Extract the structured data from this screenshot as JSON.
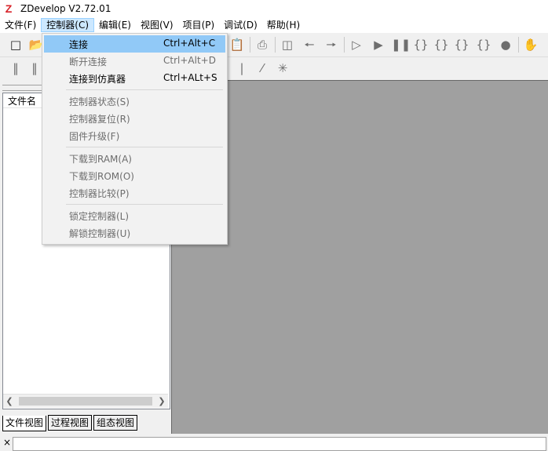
{
  "window": {
    "title": "ZDevelop V2.72.01",
    "icon": "Z"
  },
  "menubar": [
    {
      "label": "文件(F)",
      "active": false
    },
    {
      "label": "控制器(C)",
      "active": true
    },
    {
      "label": "编辑(E)",
      "active": false
    },
    {
      "label": "视图(V)",
      "active": false
    },
    {
      "label": "项目(P)",
      "active": false
    },
    {
      "label": "调试(D)",
      "active": false
    },
    {
      "label": "帮助(H)",
      "active": false
    }
  ],
  "controller_menu": {
    "items": [
      {
        "label": "连接",
        "shortcut": "Ctrl+Alt+C",
        "enabled": true,
        "highlighted": true
      },
      {
        "label": "断开连接",
        "shortcut": "Ctrl+Alt+D",
        "enabled": false
      },
      {
        "label": "连接到仿真器",
        "shortcut": "Ctrl+ALt+S",
        "enabled": true
      },
      {
        "label": "控制器状态(S)",
        "shortcut": "",
        "enabled": false
      },
      {
        "label": "控制器复位(R)",
        "shortcut": "",
        "enabled": false
      },
      {
        "label": "固件升级(F)",
        "shortcut": "",
        "enabled": false
      },
      {
        "label": "下载到RAM(A)",
        "shortcut": "",
        "enabled": false
      },
      {
        "label": "下载到ROM(O)",
        "shortcut": "",
        "enabled": false
      },
      {
        "label": "控制器比较(P)",
        "shortcut": "",
        "enabled": false
      },
      {
        "label": "锁定控制器(L)",
        "shortcut": "",
        "enabled": false
      },
      {
        "label": "解锁控制器(U)",
        "shortcut": "",
        "enabled": false
      }
    ]
  },
  "left_panel": {
    "column_header": "文件名",
    "tabs": [
      {
        "label": "文件视图",
        "active": true
      },
      {
        "label": "过程视图",
        "active": false
      },
      {
        "label": "组态视图",
        "active": false
      }
    ]
  },
  "statusbar": {
    "close_glyph": "×"
  },
  "colors": {
    "workarea": "#a0a0a0",
    "menu_highlight": "#91c9f7",
    "active_menu": "#cce8ff",
    "app_icon": "#d8232a"
  }
}
